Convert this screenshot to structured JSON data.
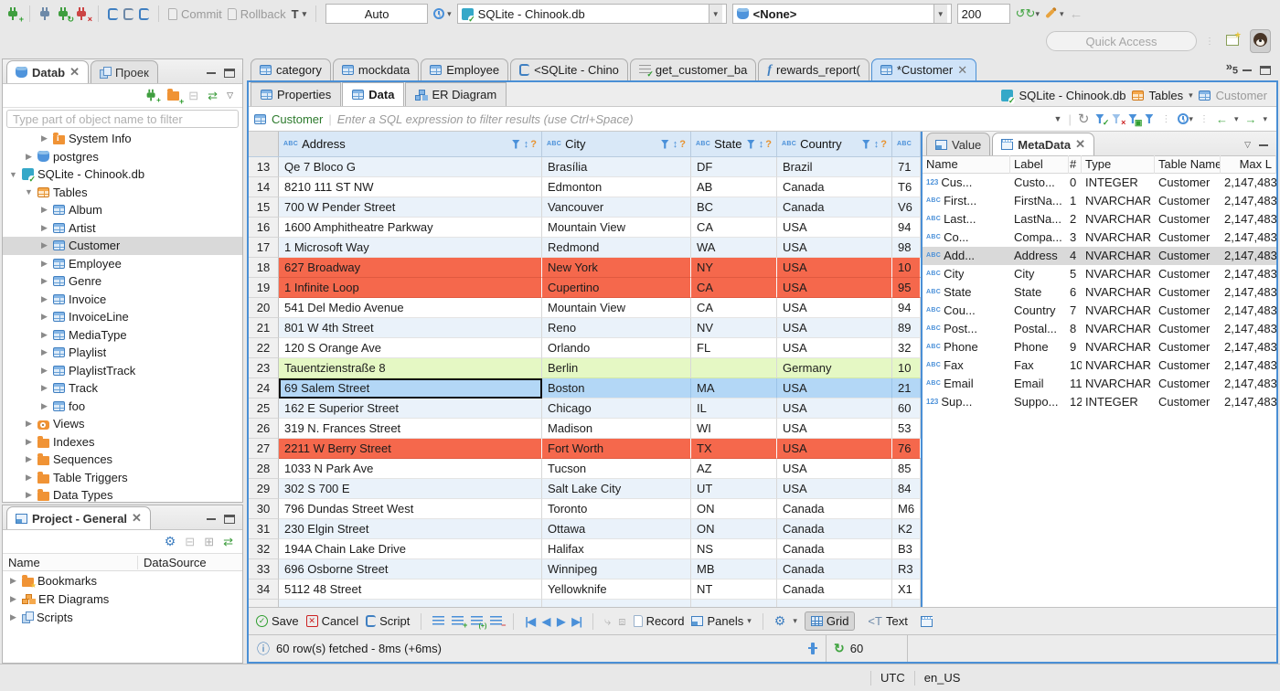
{
  "colors": {
    "focus_border": "#4a8fd5",
    "row_red": "#f5684c",
    "row_green": "#e5f8c4",
    "row_selected": "#b3d7f6",
    "row_alt": "#eaf2fa",
    "grid_header_bg": "#d9e8f7",
    "accent_blue": "#4a90d9"
  },
  "topbar": {
    "commit": "Commit",
    "rollback": "Rollback",
    "auto": "Auto",
    "connection": "SQLite - Chinook.db",
    "database": "<None>",
    "fetch_size": "200",
    "quick_access": "Quick Access"
  },
  "navigator": {
    "tab_database": "Datab",
    "tab_project": "Проек",
    "filter_placeholder": "Type part of object name to filter",
    "tree": [
      {
        "label": "System Info",
        "icon": "folder-info",
        "indent": 2,
        "arrow": "right"
      },
      {
        "label": "postgres",
        "icon": "db",
        "indent": 1,
        "arrow": "right"
      },
      {
        "label": "SQLite - Chinook.db",
        "icon": "db-file",
        "indent": 0,
        "arrow": "down"
      },
      {
        "label": "Tables",
        "icon": "table-orange",
        "indent": 1,
        "arrow": "down"
      },
      {
        "label": "Album",
        "icon": "table",
        "indent": 2,
        "arrow": "right"
      },
      {
        "label": "Artist",
        "icon": "table",
        "indent": 2,
        "arrow": "right"
      },
      {
        "label": "Customer",
        "icon": "table",
        "indent": 2,
        "arrow": "right",
        "selected": true
      },
      {
        "label": "Employee",
        "icon": "table",
        "indent": 2,
        "arrow": "right"
      },
      {
        "label": "Genre",
        "icon": "table",
        "indent": 2,
        "arrow": "right"
      },
      {
        "label": "Invoice",
        "icon": "table",
        "indent": 2,
        "arrow": "right"
      },
      {
        "label": "InvoiceLine",
        "icon": "table",
        "indent": 2,
        "arrow": "right"
      },
      {
        "label": "MediaType",
        "icon": "table",
        "indent": 2,
        "arrow": "right"
      },
      {
        "label": "Playlist",
        "icon": "table",
        "indent": 2,
        "arrow": "right"
      },
      {
        "label": "PlaylistTrack",
        "icon": "table",
        "indent": 2,
        "arrow": "right"
      },
      {
        "label": "Track",
        "icon": "table",
        "indent": 2,
        "arrow": "right"
      },
      {
        "label": "foo",
        "icon": "table",
        "indent": 2,
        "arrow": "right"
      },
      {
        "label": "Views",
        "icon": "eye",
        "indent": 1,
        "arrow": "right"
      },
      {
        "label": "Indexes",
        "icon": "folder",
        "indent": 1,
        "arrow": "right"
      },
      {
        "label": "Sequences",
        "icon": "folder",
        "indent": 1,
        "arrow": "right"
      },
      {
        "label": "Table Triggers",
        "icon": "folder",
        "indent": 1,
        "arrow": "right"
      },
      {
        "label": "Data Types",
        "icon": "folder",
        "indent": 1,
        "arrow": "right"
      }
    ]
  },
  "project": {
    "title": "Project - General",
    "col_name": "Name",
    "col_datasource": "DataSource",
    "items": [
      {
        "label": "Bookmarks",
        "icon": "folder-star"
      },
      {
        "label": "ER Diagrams",
        "icon": "er"
      },
      {
        "label": "Scripts",
        "icon": "scripts"
      }
    ]
  },
  "editor": {
    "tabs": [
      {
        "label": "category",
        "icon": "table"
      },
      {
        "label": "mockdata",
        "icon": "table"
      },
      {
        "label": "Employee",
        "icon": "table"
      },
      {
        "label": "<SQLite - Chino",
        "icon": "sql"
      },
      {
        "label": "get_customer_ba",
        "icon": "proc"
      },
      {
        "label": "rewards_report(",
        "icon": "func"
      },
      {
        "label": "*Customer",
        "icon": "table",
        "active": true,
        "closable": true
      }
    ],
    "overflow_count": "5",
    "subtabs": [
      {
        "label": "Properties",
        "icon": "table"
      },
      {
        "label": "Data",
        "icon": "data",
        "active": true
      },
      {
        "label": "ER Diagram",
        "icon": "er2"
      }
    ],
    "breadcrumb": {
      "connection": "SQLite - Chinook.db",
      "container": "Tables",
      "table": "Customer"
    },
    "filter_table": "Customer",
    "filter_placeholder": "Enter a SQL expression to filter results (use Ctrl+Space)"
  },
  "grid": {
    "columns": [
      "Address",
      "City",
      "State",
      "Country"
    ],
    "rows": [
      {
        "n": "13",
        "address": "Qe 7 Bloco G",
        "city": "Brasília",
        "state": "DF",
        "country": "Brazil",
        "postal": "71",
        "style": "alt"
      },
      {
        "n": "14",
        "address": "8210 111 ST NW",
        "city": "Edmonton",
        "state": "AB",
        "country": "Canada",
        "postal": "T6",
        "style": "plain"
      },
      {
        "n": "15",
        "address": "700 W Pender Street",
        "city": "Vancouver",
        "state": "BC",
        "country": "Canada",
        "postal": "V6",
        "style": "alt"
      },
      {
        "n": "16",
        "address": "1600 Amphitheatre Parkway",
        "city": "Mountain View",
        "state": "CA",
        "country": "USA",
        "postal": "94",
        "style": "plain"
      },
      {
        "n": "17",
        "address": "1 Microsoft Way",
        "city": "Redmond",
        "state": "WA",
        "country": "USA",
        "postal": "98",
        "style": "alt"
      },
      {
        "n": "18",
        "address": "627 Broadway",
        "city": "New York",
        "state": "NY",
        "country": "USA",
        "postal": "10",
        "style": "red"
      },
      {
        "n": "19",
        "address": "1 Infinite Loop",
        "city": "Cupertino",
        "state": "CA",
        "country": "USA",
        "postal": "95",
        "style": "red"
      },
      {
        "n": "20",
        "address": "541 Del Medio Avenue",
        "city": "Mountain View",
        "state": "CA",
        "country": "USA",
        "postal": "94",
        "style": "plain"
      },
      {
        "n": "21",
        "address": "801 W 4th Street",
        "city": "Reno",
        "state": "NV",
        "country": "USA",
        "postal": "89",
        "style": "alt"
      },
      {
        "n": "22",
        "address": "120 S Orange Ave",
        "city": "Orlando",
        "state": "FL",
        "country": "USA",
        "postal": "32",
        "style": "plain"
      },
      {
        "n": "23",
        "address": "Tauentzienstraße 8",
        "city": "Berlin",
        "state": "",
        "country": "Germany",
        "postal": "10",
        "style": "green"
      },
      {
        "n": "24",
        "address": "69 Salem Street",
        "city": "Boston",
        "state": "MA",
        "country": "USA",
        "postal": "21",
        "style": "selected",
        "focused": true
      },
      {
        "n": "25",
        "address": "162 E Superior Street",
        "city": "Chicago",
        "state": "IL",
        "country": "USA",
        "postal": "60",
        "style": "alt"
      },
      {
        "n": "26",
        "address": "319 N. Frances Street",
        "city": "Madison",
        "state": "WI",
        "country": "USA",
        "postal": "53",
        "style": "plain"
      },
      {
        "n": "27",
        "address": "2211 W Berry Street",
        "city": "Fort Worth",
        "state": "TX",
        "country": "USA",
        "postal": "76",
        "style": "red"
      },
      {
        "n": "28",
        "address": "1033 N Park Ave",
        "city": "Tucson",
        "state": "AZ",
        "country": "USA",
        "postal": "85",
        "style": "plain"
      },
      {
        "n": "29",
        "address": "302 S 700 E",
        "city": "Salt Lake City",
        "state": "UT",
        "country": "USA",
        "postal": "84",
        "style": "alt"
      },
      {
        "n": "30",
        "address": "796 Dundas Street West",
        "city": "Toronto",
        "state": "ON",
        "country": "Canada",
        "postal": "M6",
        "style": "plain"
      },
      {
        "n": "31",
        "address": "230 Elgin Street",
        "city": "Ottawa",
        "state": "ON",
        "country": "Canada",
        "postal": "K2",
        "style": "alt"
      },
      {
        "n": "32",
        "address": "194A Chain Lake Drive",
        "city": "Halifax",
        "state": "NS",
        "country": "Canada",
        "postal": "B3",
        "style": "plain"
      },
      {
        "n": "33",
        "address": "696 Osborne Street",
        "city": "Winnipeg",
        "state": "MB",
        "country": "Canada",
        "postal": "R3",
        "style": "alt"
      },
      {
        "n": "34",
        "address": "5112 48 Street",
        "city": "Yellowknife",
        "state": "NT",
        "country": "Canada",
        "postal": "X1",
        "style": "plain"
      }
    ]
  },
  "metadata": {
    "tab_value": "Value",
    "tab_metadata": "MetaData",
    "columns": [
      "Name",
      "Label",
      "#",
      "Type",
      "Table Name",
      "Max L"
    ],
    "rows": [
      {
        "icon": "123",
        "name": "Cus...",
        "label": "Custo...",
        "num": "0",
        "type": "INTEGER",
        "table": "Customer",
        "max": "2,147,483"
      },
      {
        "icon": "abc",
        "name": "First...",
        "label": "FirstNa...",
        "num": "1",
        "type": "NVARCHAR",
        "table": "Customer",
        "max": "2,147,483"
      },
      {
        "icon": "abc",
        "name": "Last...",
        "label": "LastNa...",
        "num": "2",
        "type": "NVARCHAR",
        "table": "Customer",
        "max": "2,147,483"
      },
      {
        "icon": "abc",
        "name": "Co...",
        "label": "Compa...",
        "num": "3",
        "type": "NVARCHAR",
        "table": "Customer",
        "max": "2,147,483"
      },
      {
        "icon": "abc",
        "name": "Add...",
        "label": "Address",
        "num": "4",
        "type": "NVARCHAR",
        "table": "Customer",
        "max": "2,147,483",
        "selected": true
      },
      {
        "icon": "abc",
        "name": "City",
        "label": "City",
        "num": "5",
        "type": "NVARCHAR",
        "table": "Customer",
        "max": "2,147,483"
      },
      {
        "icon": "abc",
        "name": "State",
        "label": "State",
        "num": "6",
        "type": "NVARCHAR",
        "table": "Customer",
        "max": "2,147,483"
      },
      {
        "icon": "abc",
        "name": "Cou...",
        "label": "Country",
        "num": "7",
        "type": "NVARCHAR",
        "table": "Customer",
        "max": "2,147,483"
      },
      {
        "icon": "abc",
        "name": "Post...",
        "label": "Postal...",
        "num": "8",
        "type": "NVARCHAR",
        "table": "Customer",
        "max": "2,147,483"
      },
      {
        "icon": "abc",
        "name": "Phone",
        "label": "Phone",
        "num": "9",
        "type": "NVARCHAR",
        "table": "Customer",
        "max": "2,147,483"
      },
      {
        "icon": "abc",
        "name": "Fax",
        "label": "Fax",
        "num": "10",
        "type": "NVARCHAR",
        "table": "Customer",
        "max": "2,147,483"
      },
      {
        "icon": "abc",
        "name": "Email",
        "label": "Email",
        "num": "11",
        "type": "NVARCHAR",
        "table": "Customer",
        "max": "2,147,483"
      },
      {
        "icon": "123",
        "name": "Sup...",
        "label": "Suppo...",
        "num": "12",
        "type": "INTEGER",
        "table": "Customer",
        "max": "2,147,483"
      }
    ]
  },
  "result_toolbar": {
    "save": "Save",
    "cancel": "Cancel",
    "script": "Script",
    "record": "Record",
    "panels": "Panels",
    "grid": "Grid",
    "text": "Text"
  },
  "status": {
    "message": "60 row(s) fetched - 8ms (+6ms)",
    "refresh_count": "60",
    "timezone": "UTC",
    "locale": "en_US"
  }
}
